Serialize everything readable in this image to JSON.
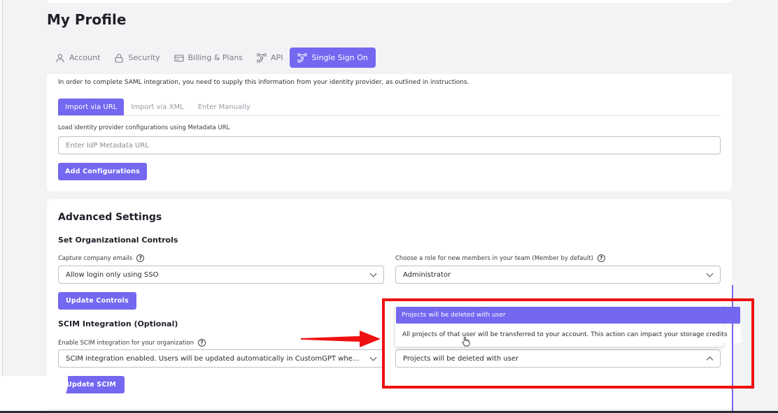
{
  "page": {
    "title": "My Profile"
  },
  "tabs": [
    {
      "label": "Account",
      "icon": "user-icon",
      "active": false
    },
    {
      "label": "Security",
      "icon": "lock-icon",
      "active": false
    },
    {
      "label": "Billing & Plans",
      "icon": "credit-card-icon",
      "active": false
    },
    {
      "label": "API",
      "icon": "api-nodes-icon",
      "active": false
    },
    {
      "label": "Single Sign On",
      "icon": "sso-nodes-icon",
      "active": true
    }
  ],
  "saml": {
    "intro": "In order to complete SAML integration, you need to supply this information from your identity provider, as outlined in instructions.",
    "subtabs": [
      {
        "label": "Import via URL",
        "active": true
      },
      {
        "label": "Import via XML",
        "active": false
      },
      {
        "label": "Enter Manually",
        "active": false
      }
    ],
    "metadata_label": "Load identity provider configurations using Metadata URL",
    "metadata_placeholder": "Enter IdP Metadata URL",
    "add_button": "Add Configurations"
  },
  "advanced": {
    "title": "Advanced Settings",
    "org_controls": {
      "title": "Set Organizational Controls",
      "capture_label": "Capture company emails",
      "capture_value": "Allow login only using SSO",
      "role_label": "Choose a role for new members in your team (Member by default)",
      "role_value": "Administrator",
      "update_button": "Update Controls"
    },
    "scim": {
      "title": "SCIM Integration (Optional)",
      "enable_label": "Enable SCIM integration for your organization",
      "enable_value": "SCIM integration enabled. Users will be updated automatically in CustomGPT whe...",
      "delete_value": "Projects will be deleted with user",
      "update_button": "Update SCIM"
    },
    "dropdown_options": [
      "Projects will be deleted with user",
      "All projects of that user will be transferred to your account. This action can impact your storage credits"
    ]
  },
  "help_glyph": "?",
  "colors": {
    "accent": "#7467f0",
    "highlight": "#ee1111"
  }
}
